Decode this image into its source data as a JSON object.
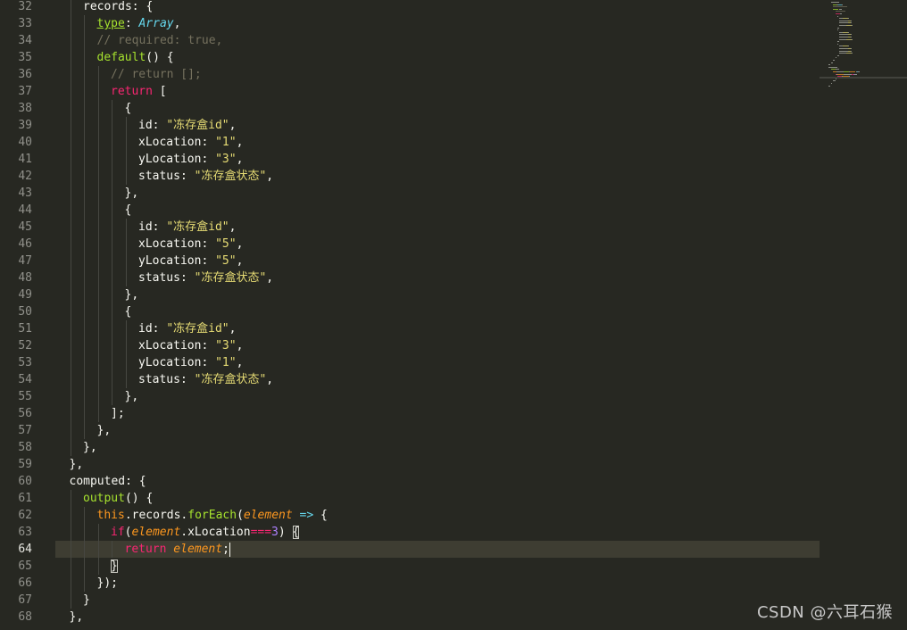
{
  "editor": {
    "theme_colors": {
      "background": "#272822",
      "keyword": "#f92672",
      "function": "#a6e22e",
      "string": "#e6db74",
      "number": "#ae81ff",
      "comment": "#75715e",
      "type": "#66d9ef",
      "parameter": "#fd971f",
      "active_line": "#3e3d32"
    },
    "active_line_number": "64",
    "lines": [
      {
        "n": "32",
        "indent": 2,
        "tokens": [
          [
            "plain",
            "records: {"
          ]
        ]
      },
      {
        "n": "33",
        "indent": 3,
        "tokens": [
          [
            "key-ul",
            "type"
          ],
          [
            "plain",
            ": "
          ],
          [
            "type",
            "Array"
          ],
          [
            "plain",
            ","
          ]
        ]
      },
      {
        "n": "34",
        "indent": 3,
        "tokens": [
          [
            "com",
            "// required: true,"
          ]
        ]
      },
      {
        "n": "35",
        "indent": 3,
        "tokens": [
          [
            "fn",
            "default"
          ],
          [
            "plain",
            "() {"
          ]
        ]
      },
      {
        "n": "36",
        "indent": 4,
        "tokens": [
          [
            "com",
            "// return [];"
          ]
        ]
      },
      {
        "n": "37",
        "indent": 4,
        "tokens": [
          [
            "kw",
            "return"
          ],
          [
            "plain",
            " ["
          ]
        ]
      },
      {
        "n": "38",
        "indent": 5,
        "tokens": [
          [
            "plain",
            "{"
          ]
        ]
      },
      {
        "n": "39",
        "indent": 6,
        "tokens": [
          [
            "plain",
            "id: "
          ],
          [
            "str",
            "\"冻存盒id\""
          ],
          [
            "plain",
            ","
          ]
        ]
      },
      {
        "n": "40",
        "indent": 6,
        "tokens": [
          [
            "plain",
            "xLocation: "
          ],
          [
            "str",
            "\"1\""
          ],
          [
            "plain",
            ","
          ]
        ]
      },
      {
        "n": "41",
        "indent": 6,
        "tokens": [
          [
            "plain",
            "yLocation: "
          ],
          [
            "str",
            "\"3\""
          ],
          [
            "plain",
            ","
          ]
        ]
      },
      {
        "n": "42",
        "indent": 6,
        "tokens": [
          [
            "plain",
            "status: "
          ],
          [
            "str",
            "\"冻存盒状态\""
          ],
          [
            "plain",
            ","
          ]
        ]
      },
      {
        "n": "43",
        "indent": 5,
        "tokens": [
          [
            "plain",
            "},"
          ]
        ]
      },
      {
        "n": "44",
        "indent": 5,
        "tokens": [
          [
            "plain",
            "{"
          ]
        ]
      },
      {
        "n": "45",
        "indent": 6,
        "tokens": [
          [
            "plain",
            "id: "
          ],
          [
            "str",
            "\"冻存盒id\""
          ],
          [
            "plain",
            ","
          ]
        ]
      },
      {
        "n": "46",
        "indent": 6,
        "tokens": [
          [
            "plain",
            "xLocation: "
          ],
          [
            "str",
            "\"5\""
          ],
          [
            "plain",
            ","
          ]
        ]
      },
      {
        "n": "47",
        "indent": 6,
        "tokens": [
          [
            "plain",
            "yLocation: "
          ],
          [
            "str",
            "\"5\""
          ],
          [
            "plain",
            ","
          ]
        ]
      },
      {
        "n": "48",
        "indent": 6,
        "tokens": [
          [
            "plain",
            "status: "
          ],
          [
            "str",
            "\"冻存盒状态\""
          ],
          [
            "plain",
            ","
          ]
        ]
      },
      {
        "n": "49",
        "indent": 5,
        "tokens": [
          [
            "plain",
            "},"
          ]
        ]
      },
      {
        "n": "50",
        "indent": 5,
        "tokens": [
          [
            "plain",
            "{"
          ]
        ]
      },
      {
        "n": "51",
        "indent": 6,
        "tokens": [
          [
            "plain",
            "id: "
          ],
          [
            "str",
            "\"冻存盒id\""
          ],
          [
            "plain",
            ","
          ]
        ]
      },
      {
        "n": "52",
        "indent": 6,
        "tokens": [
          [
            "plain",
            "xLocation: "
          ],
          [
            "str",
            "\"3\""
          ],
          [
            "plain",
            ","
          ]
        ]
      },
      {
        "n": "53",
        "indent": 6,
        "tokens": [
          [
            "plain",
            "yLocation: "
          ],
          [
            "str",
            "\"1\""
          ],
          [
            "plain",
            ","
          ]
        ]
      },
      {
        "n": "54",
        "indent": 6,
        "tokens": [
          [
            "plain",
            "status: "
          ],
          [
            "str",
            "\"冻存盒状态\""
          ],
          [
            "plain",
            ","
          ]
        ]
      },
      {
        "n": "55",
        "indent": 5,
        "tokens": [
          [
            "plain",
            "},"
          ]
        ]
      },
      {
        "n": "56",
        "indent": 4,
        "tokens": [
          [
            "plain",
            "];"
          ]
        ]
      },
      {
        "n": "57",
        "indent": 3,
        "tokens": [
          [
            "plain",
            "},"
          ]
        ]
      },
      {
        "n": "58",
        "indent": 2,
        "tokens": [
          [
            "plain",
            "},"
          ]
        ]
      },
      {
        "n": "59",
        "indent": 1,
        "tokens": [
          [
            "plain",
            "},"
          ]
        ]
      },
      {
        "n": "60",
        "indent": 1,
        "tokens": [
          [
            "plain",
            "computed: {"
          ]
        ]
      },
      {
        "n": "61",
        "indent": 2,
        "tokens": [
          [
            "fn",
            "output"
          ],
          [
            "plain",
            "() {"
          ]
        ]
      },
      {
        "n": "62",
        "indent": 3,
        "tokens": [
          [
            "this",
            "this"
          ],
          [
            "plain",
            ".records."
          ],
          [
            "fn",
            "forEach"
          ],
          [
            "plain",
            "("
          ],
          [
            "param",
            "element"
          ],
          [
            "plain",
            " "
          ],
          [
            "arrow",
            "=>"
          ],
          [
            "plain",
            " {"
          ]
        ]
      },
      {
        "n": "63",
        "indent": 4,
        "tokens": [
          [
            "kw",
            "if"
          ],
          [
            "plain",
            "("
          ],
          [
            "param",
            "element"
          ],
          [
            "plain",
            ".xLocation"
          ],
          [
            "op",
            "==="
          ],
          [
            "num",
            "3"
          ],
          [
            "plain",
            ") "
          ],
          [
            "brace",
            "{"
          ]
        ]
      },
      {
        "n": "64",
        "indent": 5,
        "tokens": [
          [
            "kw",
            "return"
          ],
          [
            "plain",
            " "
          ],
          [
            "param",
            "element"
          ],
          [
            "plain",
            ";"
          ],
          [
            "cursor",
            ""
          ]
        ]
      },
      {
        "n": "65",
        "indent": 4,
        "tokens": [
          [
            "brace",
            "}"
          ]
        ]
      },
      {
        "n": "66",
        "indent": 3,
        "tokens": [
          [
            "plain",
            "});"
          ]
        ]
      },
      {
        "n": "67",
        "indent": 2,
        "tokens": [
          [
            "plain",
            "}"
          ]
        ]
      },
      {
        "n": "68",
        "indent": 1,
        "tokens": [
          [
            "plain",
            "},"
          ]
        ]
      }
    ]
  },
  "watermark": {
    "text": "CSDN @六耳石猴"
  }
}
